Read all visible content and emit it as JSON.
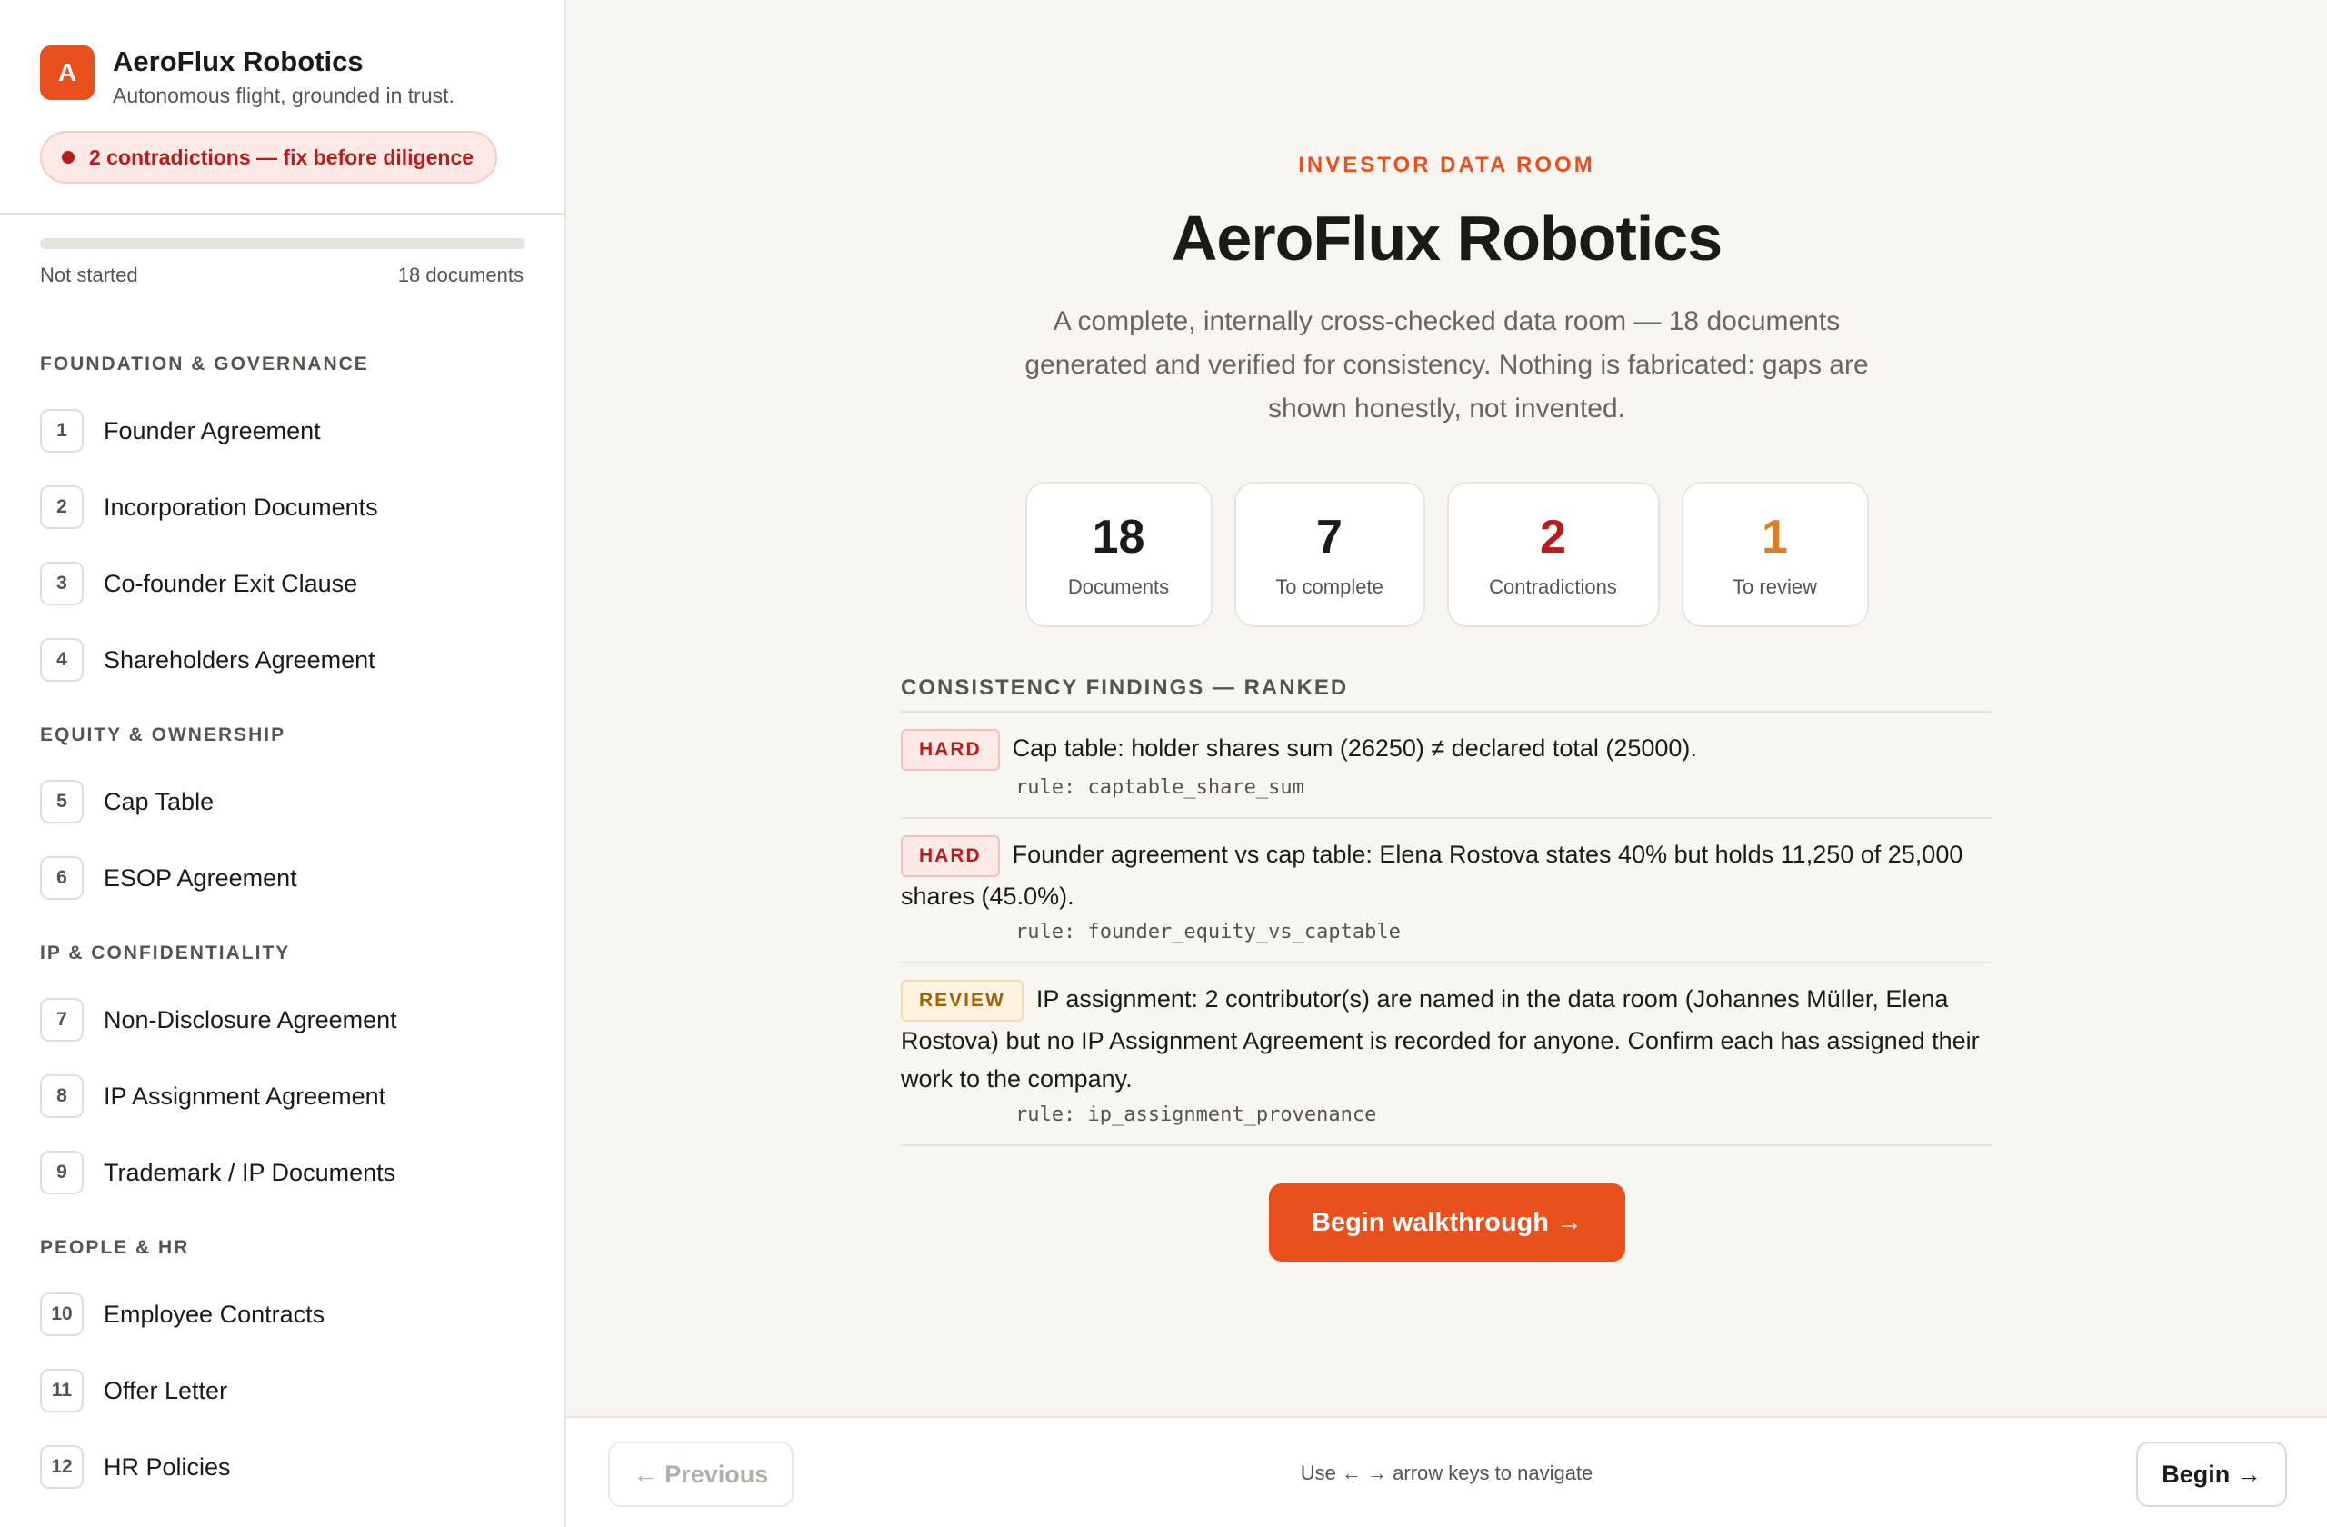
{
  "brand": {
    "logo_letter": "A",
    "name": "AeroFlux Robotics",
    "tagline": "Autonomous flight, grounded in trust."
  },
  "alert": {
    "text": "2 contradictions — fix before diligence",
    "color": "#b91c1c"
  },
  "progress": {
    "status": "Not started",
    "count": "18 documents",
    "fraction": 0
  },
  "sections": [
    {
      "title": "FOUNDATION & GOVERNANCE",
      "items": [
        {
          "num": "1",
          "label": "Founder Agreement"
        },
        {
          "num": "2",
          "label": "Incorporation Documents"
        },
        {
          "num": "3",
          "label": "Co-founder Exit Clause"
        },
        {
          "num": "4",
          "label": "Shareholders Agreement"
        }
      ]
    },
    {
      "title": "EQUITY & OWNERSHIP",
      "items": [
        {
          "num": "5",
          "label": "Cap Table"
        },
        {
          "num": "6",
          "label": "ESOP Agreement"
        }
      ]
    },
    {
      "title": "IP & CONFIDENTIALITY",
      "items": [
        {
          "num": "7",
          "label": "Non-Disclosure Agreement"
        },
        {
          "num": "8",
          "label": "IP Assignment Agreement"
        },
        {
          "num": "9",
          "label": "Trademark / IP Documents"
        }
      ]
    },
    {
      "title": "PEOPLE & HR",
      "items": [
        {
          "num": "10",
          "label": "Employee Contracts"
        },
        {
          "num": "11",
          "label": "Offer Letter"
        },
        {
          "num": "12",
          "label": "HR Policies"
        }
      ]
    }
  ],
  "hero": {
    "eyebrow": "INVESTOR DATA ROOM",
    "title": "AeroFlux Robotics",
    "subtitle": "A complete, internally cross-checked data room — 18 documents generated and verified for consistency. Nothing is fabricated: gaps are shown honestly, not invented."
  },
  "stats": [
    {
      "value": "18",
      "label": "Documents",
      "color": "#1c1917"
    },
    {
      "value": "7",
      "label": "To complete",
      "color": "#1c1917"
    },
    {
      "value": "2",
      "label": "Contradictions",
      "color": "#b91c1c"
    },
    {
      "value": "1",
      "label": "To review",
      "color": "#d97f2a"
    }
  ],
  "findings": {
    "title": "CONSISTENCY FINDINGS — RANKED",
    "items": [
      {
        "badge": "HARD",
        "kind": "hard",
        "text": "Cap table: holder shares sum (26250) ≠ declared total (25000).",
        "rule": "rule: captable_share_sum"
      },
      {
        "badge": "HARD",
        "kind": "hard",
        "text": "Founder agreement vs cap table: Elena Rostova states 40% but holds 11,250 of 25,000 shares (45.0%).",
        "rule": "rule: founder_equity_vs_captable"
      },
      {
        "badge": "REVIEW",
        "kind": "review",
        "text": "IP assignment: 2 contributor(s) are named in the data room (Johannes Müller, Elena Rostova) but no IP Assignment Agreement is recorded for anyone. Confirm each has assigned their work to the company.",
        "rule": "rule: ip_assignment_provenance"
      }
    ]
  },
  "cta": {
    "label": "Begin walkthrough →"
  },
  "footer": {
    "prev_label": "← Previous",
    "hint": "Use ← → arrow keys to navigate",
    "next_label": "Begin →"
  },
  "colors": {
    "accent": "#e8511e",
    "danger": "#b91c1c",
    "warning": "#d97f2a"
  }
}
